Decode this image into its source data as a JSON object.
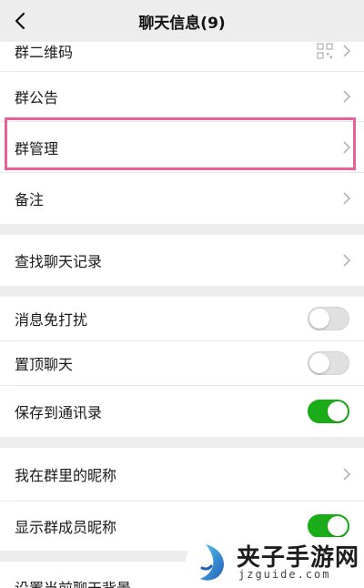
{
  "header": {
    "title": "聊天信息(9)"
  },
  "rows": {
    "qrcode": "群二维码",
    "notice": "群公告",
    "manage": "群管理",
    "remark": "备注",
    "search": "查找聊天记录",
    "mute": "消息免打扰",
    "pin": "置顶聊天",
    "save": "保存到通讯录",
    "nickname": "我在群里的昵称",
    "show_nick": "显示群成员昵称",
    "background": "设置当前聊天背景"
  },
  "toggles": {
    "mute": false,
    "pin": false,
    "save": true,
    "show_nick": true
  },
  "colors": {
    "toggle_on": "#1aad19",
    "highlight": "#e8609a"
  },
  "icons": {
    "back": "back-arrow-icon",
    "chevron": "chevron-right-icon",
    "qr": "qr-code-icon"
  },
  "watermark": {
    "brand": "夹子手游网",
    "domain": "jzguide.com"
  }
}
